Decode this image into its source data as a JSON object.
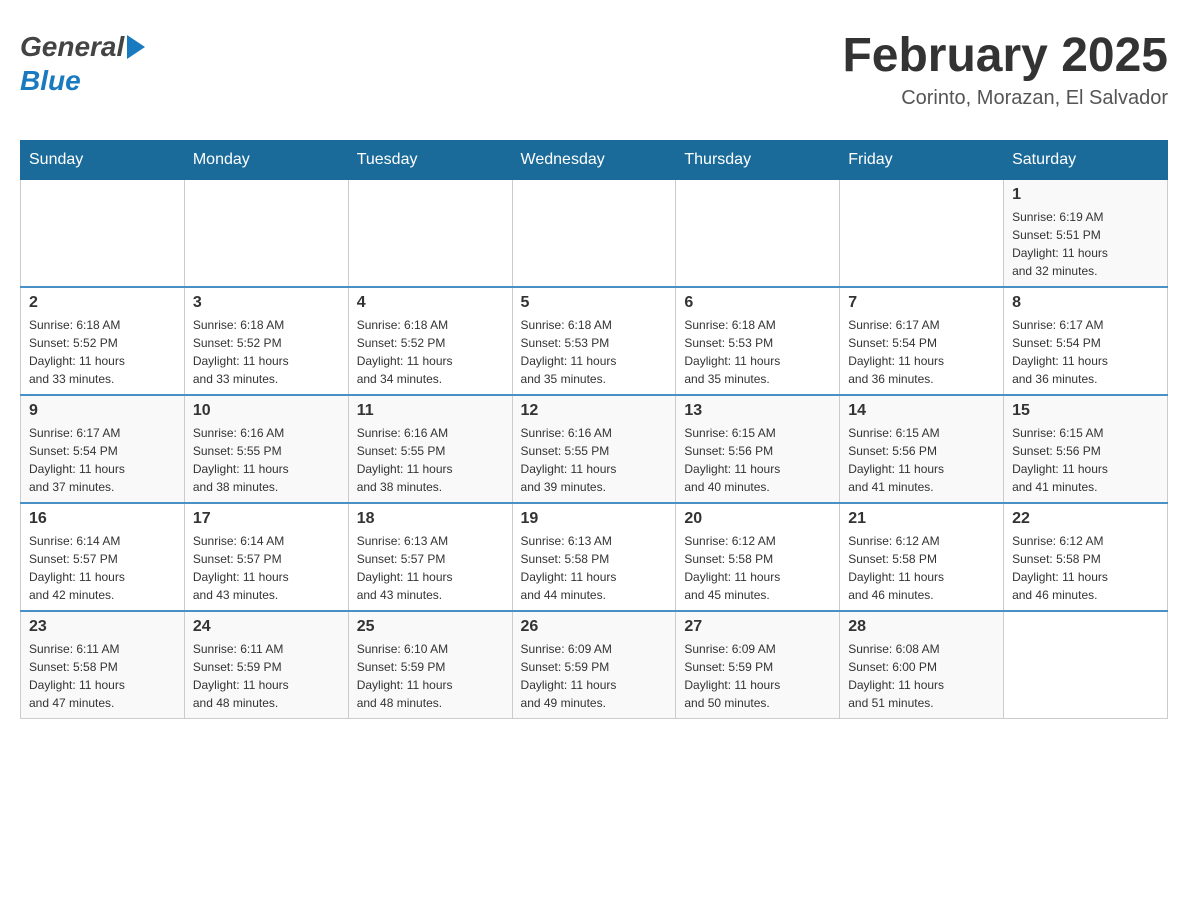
{
  "header": {
    "title": "February 2025",
    "subtitle": "Corinto, Morazan, El Salvador",
    "logo_general": "General",
    "logo_blue": "Blue"
  },
  "days_of_week": [
    "Sunday",
    "Monday",
    "Tuesday",
    "Wednesday",
    "Thursday",
    "Friday",
    "Saturday"
  ],
  "weeks": [
    {
      "days": [
        {
          "date": "",
          "info": ""
        },
        {
          "date": "",
          "info": ""
        },
        {
          "date": "",
          "info": ""
        },
        {
          "date": "",
          "info": ""
        },
        {
          "date": "",
          "info": ""
        },
        {
          "date": "",
          "info": ""
        },
        {
          "date": "1",
          "info": "Sunrise: 6:19 AM\nSunset: 5:51 PM\nDaylight: 11 hours\nand 32 minutes."
        }
      ]
    },
    {
      "days": [
        {
          "date": "2",
          "info": "Sunrise: 6:18 AM\nSunset: 5:52 PM\nDaylight: 11 hours\nand 33 minutes."
        },
        {
          "date": "3",
          "info": "Sunrise: 6:18 AM\nSunset: 5:52 PM\nDaylight: 11 hours\nand 33 minutes."
        },
        {
          "date": "4",
          "info": "Sunrise: 6:18 AM\nSunset: 5:52 PM\nDaylight: 11 hours\nand 34 minutes."
        },
        {
          "date": "5",
          "info": "Sunrise: 6:18 AM\nSunset: 5:53 PM\nDaylight: 11 hours\nand 35 minutes."
        },
        {
          "date": "6",
          "info": "Sunrise: 6:18 AM\nSunset: 5:53 PM\nDaylight: 11 hours\nand 35 minutes."
        },
        {
          "date": "7",
          "info": "Sunrise: 6:17 AM\nSunset: 5:54 PM\nDaylight: 11 hours\nand 36 minutes."
        },
        {
          "date": "8",
          "info": "Sunrise: 6:17 AM\nSunset: 5:54 PM\nDaylight: 11 hours\nand 36 minutes."
        }
      ]
    },
    {
      "days": [
        {
          "date": "9",
          "info": "Sunrise: 6:17 AM\nSunset: 5:54 PM\nDaylight: 11 hours\nand 37 minutes."
        },
        {
          "date": "10",
          "info": "Sunrise: 6:16 AM\nSunset: 5:55 PM\nDaylight: 11 hours\nand 38 minutes."
        },
        {
          "date": "11",
          "info": "Sunrise: 6:16 AM\nSunset: 5:55 PM\nDaylight: 11 hours\nand 38 minutes."
        },
        {
          "date": "12",
          "info": "Sunrise: 6:16 AM\nSunset: 5:55 PM\nDaylight: 11 hours\nand 39 minutes."
        },
        {
          "date": "13",
          "info": "Sunrise: 6:15 AM\nSunset: 5:56 PM\nDaylight: 11 hours\nand 40 minutes."
        },
        {
          "date": "14",
          "info": "Sunrise: 6:15 AM\nSunset: 5:56 PM\nDaylight: 11 hours\nand 41 minutes."
        },
        {
          "date": "15",
          "info": "Sunrise: 6:15 AM\nSunset: 5:56 PM\nDaylight: 11 hours\nand 41 minutes."
        }
      ]
    },
    {
      "days": [
        {
          "date": "16",
          "info": "Sunrise: 6:14 AM\nSunset: 5:57 PM\nDaylight: 11 hours\nand 42 minutes."
        },
        {
          "date": "17",
          "info": "Sunrise: 6:14 AM\nSunset: 5:57 PM\nDaylight: 11 hours\nand 43 minutes."
        },
        {
          "date": "18",
          "info": "Sunrise: 6:13 AM\nSunset: 5:57 PM\nDaylight: 11 hours\nand 43 minutes."
        },
        {
          "date": "19",
          "info": "Sunrise: 6:13 AM\nSunset: 5:58 PM\nDaylight: 11 hours\nand 44 minutes."
        },
        {
          "date": "20",
          "info": "Sunrise: 6:12 AM\nSunset: 5:58 PM\nDaylight: 11 hours\nand 45 minutes."
        },
        {
          "date": "21",
          "info": "Sunrise: 6:12 AM\nSunset: 5:58 PM\nDaylight: 11 hours\nand 46 minutes."
        },
        {
          "date": "22",
          "info": "Sunrise: 6:12 AM\nSunset: 5:58 PM\nDaylight: 11 hours\nand 46 minutes."
        }
      ]
    },
    {
      "days": [
        {
          "date": "23",
          "info": "Sunrise: 6:11 AM\nSunset: 5:58 PM\nDaylight: 11 hours\nand 47 minutes."
        },
        {
          "date": "24",
          "info": "Sunrise: 6:11 AM\nSunset: 5:59 PM\nDaylight: 11 hours\nand 48 minutes."
        },
        {
          "date": "25",
          "info": "Sunrise: 6:10 AM\nSunset: 5:59 PM\nDaylight: 11 hours\nand 48 minutes."
        },
        {
          "date": "26",
          "info": "Sunrise: 6:09 AM\nSunset: 5:59 PM\nDaylight: 11 hours\nand 49 minutes."
        },
        {
          "date": "27",
          "info": "Sunrise: 6:09 AM\nSunset: 5:59 PM\nDaylight: 11 hours\nand 50 minutes."
        },
        {
          "date": "28",
          "info": "Sunrise: 6:08 AM\nSunset: 6:00 PM\nDaylight: 11 hours\nand 51 minutes."
        },
        {
          "date": "",
          "info": ""
        }
      ]
    }
  ]
}
